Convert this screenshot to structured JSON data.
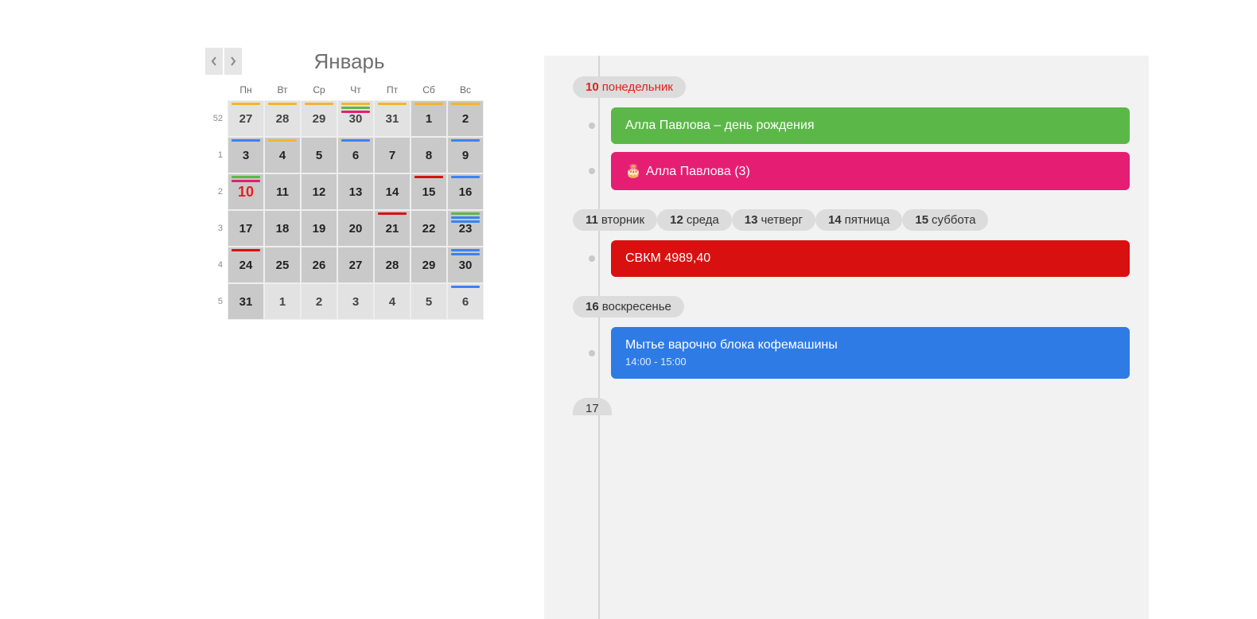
{
  "month_title": "Январь",
  "weekday_headers": [
    "Пн",
    "Вт",
    "Ср",
    "Чт",
    "Пт",
    "Сб",
    "Вс"
  ],
  "week_numbers": [
    "52",
    "1",
    "2",
    "3",
    "4",
    "5"
  ],
  "grid": [
    [
      {
        "n": "27",
        "out": true,
        "bars": [
          "orange"
        ]
      },
      {
        "n": "28",
        "out": true,
        "bars": [
          "orange"
        ]
      },
      {
        "n": "29",
        "out": true,
        "bars": [
          "orange"
        ]
      },
      {
        "n": "30",
        "out": true,
        "bars": [
          "orange",
          "green",
          "pink"
        ]
      },
      {
        "n": "31",
        "out": true,
        "bars": [
          "orange"
        ]
      },
      {
        "n": "1",
        "in": true,
        "bars": [
          "orange"
        ]
      },
      {
        "n": "2",
        "in": true,
        "bars": [
          "orange"
        ]
      }
    ],
    [
      {
        "n": "3",
        "in": true,
        "bars": [
          "blue"
        ]
      },
      {
        "n": "4",
        "in": true,
        "bars": [
          "orange"
        ]
      },
      {
        "n": "5",
        "in": true,
        "bars": []
      },
      {
        "n": "6",
        "in": true,
        "bars": [
          "blue"
        ]
      },
      {
        "n": "7",
        "in": true,
        "bars": []
      },
      {
        "n": "8",
        "in": true,
        "bars": []
      },
      {
        "n": "9",
        "in": true,
        "bars": [
          "blue"
        ]
      }
    ],
    [
      {
        "n": "10",
        "in": true,
        "sel": true,
        "bars": [
          "green",
          "pink"
        ]
      },
      {
        "n": "11",
        "in": true,
        "bars": []
      },
      {
        "n": "12",
        "in": true,
        "bars": []
      },
      {
        "n": "13",
        "in": true,
        "bars": []
      },
      {
        "n": "14",
        "in": true,
        "bars": []
      },
      {
        "n": "15",
        "in": true,
        "bars": [
          "red"
        ]
      },
      {
        "n": "16",
        "in": true,
        "bars": [
          "blue"
        ]
      }
    ],
    [
      {
        "n": "17",
        "in": true,
        "bars": []
      },
      {
        "n": "18",
        "in": true,
        "bars": []
      },
      {
        "n": "19",
        "in": true,
        "bars": []
      },
      {
        "n": "20",
        "in": true,
        "bars": []
      },
      {
        "n": "21",
        "in": true,
        "bars": [
          "red"
        ]
      },
      {
        "n": "22",
        "in": true,
        "bars": []
      },
      {
        "n": "23",
        "in": true,
        "bars": [
          "green",
          "blue",
          "blue"
        ]
      }
    ],
    [
      {
        "n": "24",
        "in": true,
        "bars": [
          "red"
        ]
      },
      {
        "n": "25",
        "in": true,
        "bars": []
      },
      {
        "n": "26",
        "in": true,
        "bars": []
      },
      {
        "n": "27",
        "in": true,
        "bars": []
      },
      {
        "n": "28",
        "in": true,
        "bars": []
      },
      {
        "n": "29",
        "in": true,
        "bars": []
      },
      {
        "n": "30",
        "in": true,
        "bars": [
          "blue",
          "blue"
        ]
      }
    ],
    [
      {
        "n": "31",
        "in": true,
        "bars": []
      },
      {
        "n": "1",
        "out": true,
        "bars": []
      },
      {
        "n": "2",
        "out": true,
        "bars": []
      },
      {
        "n": "3",
        "out": true,
        "bars": []
      },
      {
        "n": "4",
        "out": true,
        "bars": []
      },
      {
        "n": "5",
        "out": true,
        "bars": []
      },
      {
        "n": "6",
        "out": true,
        "bars": [
          "blue"
        ]
      }
    ]
  ],
  "agenda": [
    {
      "dnum": "10",
      "dname": "понедельник",
      "today": true,
      "events": [
        {
          "title": "Алла Павлова – день рождения",
          "color": "green"
        },
        {
          "title": "Алла Павлова (3)",
          "color": "pink",
          "cake": true
        }
      ]
    },
    {
      "dnum": "11",
      "dname": "вторник",
      "events": []
    },
    {
      "dnum": "12",
      "dname": "среда",
      "events": []
    },
    {
      "dnum": "13",
      "dname": "четверг",
      "events": []
    },
    {
      "dnum": "14",
      "dname": "пятница",
      "events": []
    },
    {
      "dnum": "15",
      "dname": "суббота",
      "events": [
        {
          "title": "СВКМ 4989,40",
          "color": "red"
        }
      ]
    },
    {
      "dnum": "16",
      "dname": "воскресенье",
      "events": [
        {
          "title": "Мытье варочно блока кофемашины",
          "sub": "14:00 - 15:00",
          "color": "blue"
        }
      ]
    }
  ],
  "peek_day": "17"
}
